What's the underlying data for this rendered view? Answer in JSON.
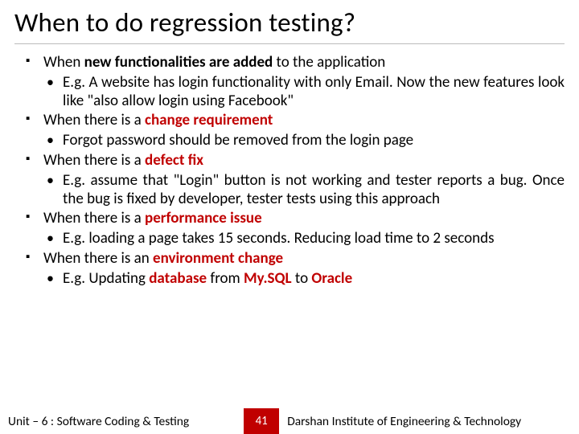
{
  "title": "When to do regression testing?",
  "bullets": {
    "b1_pre": "When ",
    "b1_bold": "new functionalities are added",
    "b1_post": " to the application",
    "b1_sub": "E.g. A website has login functionality with only Email. Now the new features look like \"also allow login using Facebook\"",
    "b2_pre": "When there is a ",
    "b2_red": "change requirement",
    "b2_sub": "Forgot password should be removed from the login page",
    "b3_pre": "When there is a ",
    "b3_red": "defect fix",
    "b3_sub": "E.g. assume that \"Login\" button is not working and tester reports a bug. Once the bug is fixed by developer, tester tests using this approach",
    "b4_pre": "When there is a ",
    "b4_red": "performance issue",
    "b4_sub": "E.g. loading a page takes 15 seconds. Reducing load time to 2 seconds",
    "b5_pre": "When there is an ",
    "b5_red": "environment change",
    "b5_sub_pre": "E.g. Updating ",
    "b5_sub_r1": "database",
    "b5_sub_mid": " from ",
    "b5_sub_r2": "My.SQL",
    "b5_sub_mid2": " to ",
    "b5_sub_r3": "Oracle"
  },
  "footer": {
    "left": "Unit – 6 : Software Coding & Testing",
    "page": "41",
    "right": "Darshan Institute of Engineering & Technology"
  }
}
